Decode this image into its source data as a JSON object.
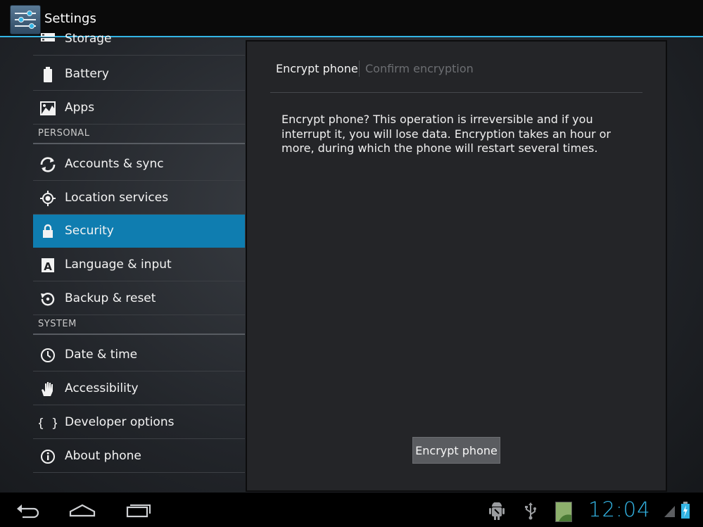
{
  "app": {
    "title": "Settings",
    "icon": "settings-sliders-icon"
  },
  "sidebar": {
    "items": [
      {
        "type": "item",
        "label": "Storage",
        "icon": "storage-icon"
      },
      {
        "type": "item",
        "label": "Battery",
        "icon": "battery-icon"
      },
      {
        "type": "item",
        "label": "Apps",
        "icon": "apps-icon"
      },
      {
        "type": "section",
        "label": "PERSONAL"
      },
      {
        "type": "item",
        "label": "Accounts & sync",
        "icon": "sync-icon"
      },
      {
        "type": "item",
        "label": "Location services",
        "icon": "location-icon"
      },
      {
        "type": "item",
        "label": "Security",
        "icon": "lock-icon",
        "selected": true
      },
      {
        "type": "item",
        "label": "Language & input",
        "icon": "language-icon"
      },
      {
        "type": "item",
        "label": "Backup & reset",
        "icon": "backup-icon"
      },
      {
        "type": "section",
        "label": "SYSTEM"
      },
      {
        "type": "item",
        "label": "Date & time",
        "icon": "clock-icon"
      },
      {
        "type": "item",
        "label": "Accessibility",
        "icon": "hand-icon"
      },
      {
        "type": "item",
        "label": "Developer options",
        "icon": "braces-icon"
      },
      {
        "type": "item",
        "label": "About phone",
        "icon": "info-icon"
      }
    ]
  },
  "detail": {
    "breadcrumb": {
      "current": "Encrypt phone",
      "next": "Confirm encryption"
    },
    "message": "Encrypt phone? This operation is irreversible and if you interrupt it, you will lose data. Encryption takes an hour or more, during which the phone will restart several times.",
    "button_label": "Encrypt phone"
  },
  "navbar": {
    "buttons": [
      "back-icon",
      "home-icon",
      "recent-apps-icon"
    ],
    "status_icons": [
      "android-debug-icon",
      "usb-icon",
      "gallery-thumbnail-icon",
      "signal-icon",
      "battery-charging-icon"
    ],
    "clock": "12:04"
  },
  "colors": {
    "accent": "#33b5e5",
    "selected": "#0f7db0"
  }
}
